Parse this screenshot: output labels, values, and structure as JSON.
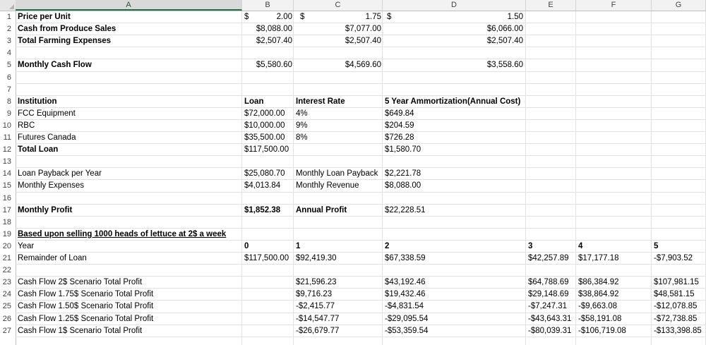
{
  "columns": [
    "A",
    "B",
    "C",
    "D",
    "E",
    "F",
    "G"
  ],
  "selected_column": "A",
  "rows": [
    {
      "num": "1",
      "cells": [
        {
          "col": "A",
          "text": "Price per Unit",
          "bold": true
        },
        {
          "col": "B",
          "text": "$",
          "pos": "b-dollar"
        },
        {
          "col": "B",
          "text": "2.00",
          "pos": "b-right"
        },
        {
          "col": "C",
          "text": "$",
          "pos": "c-dollar"
        },
        {
          "col": "C",
          "text": "1.75",
          "pos": "c-right"
        },
        {
          "col": "D",
          "text": "$",
          "pos": "d-dollar"
        },
        {
          "col": "D",
          "text": "1.50",
          "pos": "d-right"
        }
      ]
    },
    {
      "num": "2",
      "cells": [
        {
          "col": "A",
          "text": "Cash from Produce Sales",
          "bold": true
        },
        {
          "col": "B",
          "text": "$8,088.00",
          "pos": "b-right"
        },
        {
          "col": "C",
          "text": "$7,077.00",
          "pos": "c-right"
        },
        {
          "col": "D",
          "text": "$6,066.00",
          "pos": "d-right"
        }
      ]
    },
    {
      "num": "3",
      "cells": [
        {
          "col": "A",
          "text": "Total Farming Expenses",
          "bold": true
        },
        {
          "col": "B",
          "text": "$2,507.40",
          "pos": "b-right"
        },
        {
          "col": "C",
          "text": "$2,507.40",
          "pos": "c-right"
        },
        {
          "col": "D",
          "text": "$2,507.40",
          "pos": "d-right"
        }
      ]
    },
    {
      "num": "4",
      "cells": []
    },
    {
      "num": "5",
      "cells": [
        {
          "col": "A",
          "text": "Monthly Cash Flow",
          "bold": true
        },
        {
          "col": "B",
          "text": "$5,580.60",
          "pos": "b-right"
        },
        {
          "col": "C",
          "text": "$4,569.60",
          "pos": "c-right"
        },
        {
          "col": "D",
          "text": "$3,558.60",
          "pos": "d-right"
        }
      ]
    },
    {
      "num": "6",
      "cells": []
    },
    {
      "num": "7",
      "cells": []
    },
    {
      "num": "8",
      "cells": [
        {
          "col": "A",
          "text": "Institution",
          "bold": true
        },
        {
          "col": "B",
          "text": "Loan",
          "bold": true
        },
        {
          "col": "C",
          "text": "Interest Rate",
          "bold": true
        },
        {
          "col": "D",
          "text": "5 Year Ammortization(Annual Cost)",
          "bold": true
        }
      ]
    },
    {
      "num": "9",
      "cells": [
        {
          "col": "A",
          "text": "FCC Equipment"
        },
        {
          "col": "B",
          "text": "$72,000.00"
        },
        {
          "col": "C",
          "text": "4%"
        },
        {
          "col": "D",
          "text": "$649.84"
        }
      ]
    },
    {
      "num": "10",
      "cells": [
        {
          "col": "A",
          "text": "RBC"
        },
        {
          "col": "B",
          "text": "$10,000.00"
        },
        {
          "col": "C",
          "text": "9%"
        },
        {
          "col": "D",
          "text": "$204.59"
        }
      ]
    },
    {
      "num": "11",
      "cells": [
        {
          "col": "A",
          "text": "Futures Canada"
        },
        {
          "col": "B",
          "text": "$35,500.00"
        },
        {
          "col": "C",
          "text": "8%"
        },
        {
          "col": "D",
          "text": "$726.28"
        }
      ]
    },
    {
      "num": "12",
      "cells": [
        {
          "col": "A",
          "text": "Total Loan",
          "bold": true
        },
        {
          "col": "B",
          "text": "$117,500.00"
        },
        {
          "col": "D",
          "text": "$1,580.70"
        }
      ]
    },
    {
      "num": "13",
      "cells": []
    },
    {
      "num": "14",
      "cells": [
        {
          "col": "A",
          "text": " Loan Payback per Year"
        },
        {
          "col": "B",
          "text": "$25,080.70"
        },
        {
          "col": "C",
          "text": "Monthly Loan Payback"
        },
        {
          "col": "D",
          "text": "$2,221.78"
        }
      ]
    },
    {
      "num": "15",
      "cells": [
        {
          "col": "A",
          "text": "Monthly Expenses"
        },
        {
          "col": "B",
          "text": "$4,013.84"
        },
        {
          "col": "C",
          "text": "Monthly Revenue"
        },
        {
          "col": "D",
          "text": "$8,088.00"
        }
      ]
    },
    {
      "num": "16",
      "cells": []
    },
    {
      "num": "17",
      "cells": [
        {
          "col": "A",
          "text": "Monthly Profit",
          "bold": true
        },
        {
          "col": "B",
          "text": "$1,852.38",
          "bold": true
        },
        {
          "col": "C",
          "text": "Annual Profit",
          "bold": true
        },
        {
          "col": "D",
          "text": "$22,228.51"
        }
      ]
    },
    {
      "num": "18",
      "cells": []
    },
    {
      "num": "19",
      "cells": [
        {
          "col": "A",
          "text": "Based upon selling 1000 heads of lettuce at 2$ a week",
          "bold": true,
          "underline": true
        }
      ]
    },
    {
      "num": "20",
      "cells": [
        {
          "col": "A",
          "text": "Year"
        },
        {
          "col": "B",
          "text": "0",
          "bold": true
        },
        {
          "col": "C",
          "text": "1",
          "bold": true
        },
        {
          "col": "D",
          "text": "2",
          "bold": true
        },
        {
          "col": "E",
          "text": "3",
          "bold": true
        },
        {
          "col": "F",
          "text": "4",
          "bold": true
        },
        {
          "col": "G",
          "text": "5",
          "bold": true
        }
      ]
    },
    {
      "num": "21",
      "cells": [
        {
          "col": "A",
          "text": "Remainder of Loan"
        },
        {
          "col": "B",
          "text": "$117,500.00"
        },
        {
          "col": "C",
          "text": "$92,419.30"
        },
        {
          "col": "D",
          "text": "$67,338.59"
        },
        {
          "col": "E",
          "text": "$42,257.89"
        },
        {
          "col": "F",
          "text": "$17,177.18"
        },
        {
          "col": "G",
          "text": "-$7,903.52"
        }
      ]
    },
    {
      "num": "22",
      "cells": []
    },
    {
      "num": "23",
      "cells": [
        {
          "col": "A",
          "text": "Cash Flow 2$ Scenario Total Profit"
        },
        {
          "col": "C",
          "text": "$21,596.23"
        },
        {
          "col": "D",
          "text": "$43,192.46"
        },
        {
          "col": "E",
          "text": "$64,788.69"
        },
        {
          "col": "F",
          "text": "$86,384.92"
        },
        {
          "col": "G",
          "text": "$107,981.15"
        }
      ]
    },
    {
      "num": "24",
      "cells": [
        {
          "col": "A",
          "text": "Cash Flow 1.75$ Scenario Total Profit"
        },
        {
          "col": "C",
          "text": "$9,716.23"
        },
        {
          "col": "D",
          "text": "$19,432.46"
        },
        {
          "col": "E",
          "text": "$29,148.69"
        },
        {
          "col": "F",
          "text": "$38,864.92"
        },
        {
          "col": "G",
          "text": "$48,581.15"
        }
      ]
    },
    {
      "num": "25",
      "cells": [
        {
          "col": "A",
          "text": "Cash Flow 1.50$ Scenario Total Profit"
        },
        {
          "col": "C",
          "text": "-$2,415.77"
        },
        {
          "col": "D",
          "text": "-$4,831.54"
        },
        {
          "col": "E",
          "text": "-$7,247.31"
        },
        {
          "col": "F",
          "text": "-$9,663.08"
        },
        {
          "col": "G",
          "text": "-$12,078.85"
        }
      ]
    },
    {
      "num": "26",
      "cells": [
        {
          "col": "A",
          "text": "Cash Flow 1.25$ Scenario Total Profit"
        },
        {
          "col": "C",
          "text": "-$14,547.77"
        },
        {
          "col": "D",
          "text": "-$29,095.54"
        },
        {
          "col": "E",
          "text": "-$43,643.31"
        },
        {
          "col": "F",
          "text": "-$58,191.08"
        },
        {
          "col": "G",
          "text": "-$72,738.85"
        }
      ]
    },
    {
      "num": "27",
      "cells": [
        {
          "col": "A",
          "text": "Cash Flow 1$ Scenario Total Profit"
        },
        {
          "col": "C",
          "text": "-$26,679.77"
        },
        {
          "col": "D",
          "text": "-$53,359.54"
        },
        {
          "col": "E",
          "text": "-$80,039.31"
        },
        {
          "col": "F",
          "text": "-$106,719.08"
        },
        {
          "col": "G",
          "text": "-$133,398.85"
        }
      ]
    }
  ]
}
